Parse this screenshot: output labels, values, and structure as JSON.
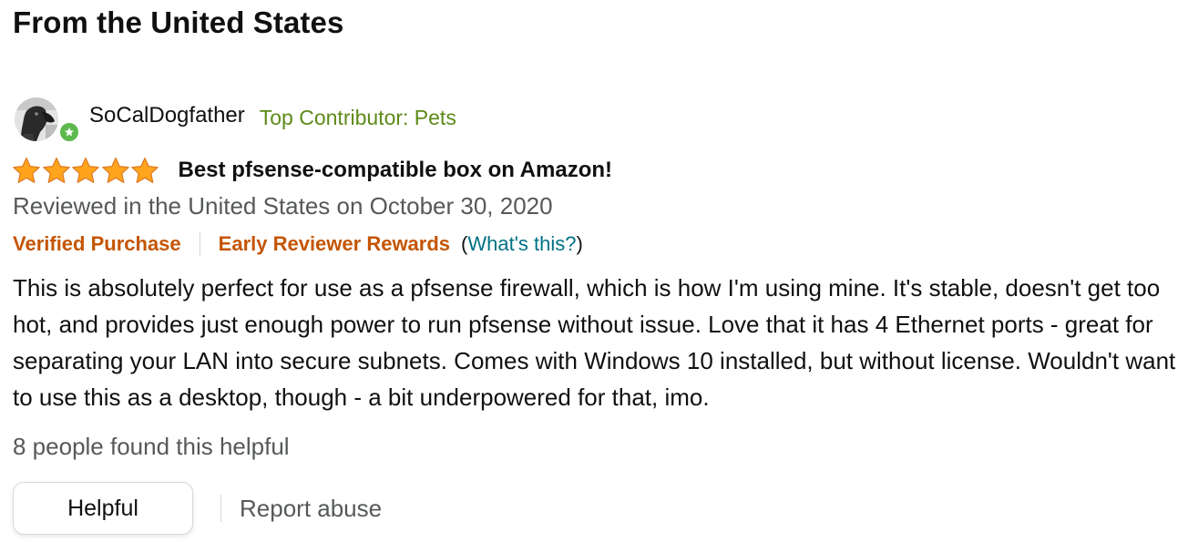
{
  "section": {
    "title": "From the United States"
  },
  "review": {
    "profile": {
      "name": "SoCalDogfather",
      "badge": "Top Contributor: Pets",
      "avatar_icon": "dog-avatar-icon"
    },
    "rating": {
      "stars": 5,
      "max_stars": 5,
      "star_color": "#ffa41c"
    },
    "title": "Best pfsense-compatible box on Amazon!",
    "date_line": "Reviewed in the United States on October 30, 2020",
    "badges": {
      "verified": "Verified Purchase",
      "early_reviewer": "Early Reviewer Rewards",
      "whats_this_open": "(",
      "whats_this": "What's this?",
      "whats_this_close": ")"
    },
    "body": "This is absolutely perfect for use as a pfsense firewall, which is how I'm using mine. It's stable, doesn't get too hot, and provides just enough power to run pfsense without issue. Love that it has 4 Ethernet ports - great for separating your LAN into secure subnets. Comes with Windows 10 installed, but without license. Wouldn't want to use this as a desktop, though - a bit underpowered for that, imo.",
    "helpful_count": "8 people found this helpful",
    "actions": {
      "helpful": "Helpful",
      "report": "Report abuse"
    }
  },
  "colors": {
    "text": "#0f1111",
    "secondary_text": "#565959",
    "badge_green": "#5d8a18",
    "orange": "#c45500",
    "link_teal": "#007185"
  }
}
